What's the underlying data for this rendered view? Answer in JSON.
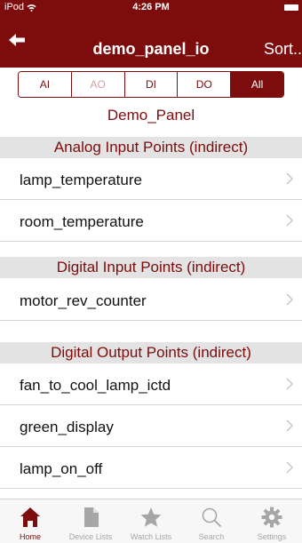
{
  "status_bar": {
    "carrier": "iPod",
    "time": "4:26 PM"
  },
  "nav": {
    "title": "demo_panel_io",
    "sort_label": "Sort.."
  },
  "filter": {
    "segments": [
      {
        "label": "AI",
        "state": "normal"
      },
      {
        "label": "AO",
        "state": "disabled"
      },
      {
        "label": "DI",
        "state": "normal"
      },
      {
        "label": "DO",
        "state": "normal"
      },
      {
        "label": "All",
        "state": "selected"
      }
    ]
  },
  "panel_title": "Demo_Panel",
  "sections": [
    {
      "title": "Analog Input Points (indirect)",
      "items": [
        "lamp_temperature",
        "room_temperature"
      ]
    },
    {
      "title": "Digital Input Points (indirect)",
      "items": [
        "motor_rev_counter"
      ]
    },
    {
      "title": "Digital Output Points (indirect)",
      "items": [
        "fan_to_cool_lamp_ictd",
        "green_display",
        "lamp_on_off"
      ]
    }
  ],
  "tab_bar": {
    "tabs": [
      {
        "label": "Home",
        "icon": "home-icon",
        "selected": true
      },
      {
        "label": "Device Lists",
        "icon": "document-icon",
        "selected": false
      },
      {
        "label": "Watch Lists",
        "icon": "star-icon",
        "selected": false
      },
      {
        "label": "Search",
        "icon": "search-icon",
        "selected": false
      },
      {
        "label": "Settings",
        "icon": "gear-icon",
        "selected": false
      }
    ]
  },
  "colors": {
    "brand": "#7d0c0c",
    "section_bg": "#e3e3e3",
    "inactive_tab": "#a6a6a6"
  }
}
